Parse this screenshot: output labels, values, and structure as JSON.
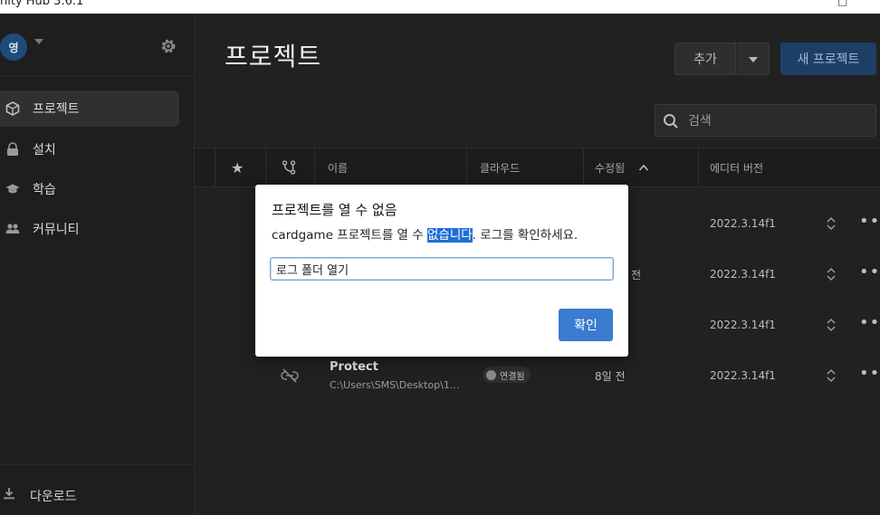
{
  "window": {
    "title": "nity Hub 3.6.1"
  },
  "sidebar": {
    "avatar_initial": "영",
    "items": [
      {
        "label": "프로젝트",
        "icon": "cube-icon",
        "active": true
      },
      {
        "label": "설치",
        "icon": "lock-icon",
        "active": false
      },
      {
        "label": "학습",
        "icon": "graduation-cap-icon",
        "active": false
      },
      {
        "label": "커뮤니티",
        "icon": "people-icon",
        "active": false
      }
    ],
    "download_label": "다운로드"
  },
  "main": {
    "page_title": "프로젝트",
    "add_label": "추가",
    "new_project_label": "새 프로젝트",
    "search_placeholder": "검색",
    "columns": {
      "name": "이름",
      "cloud": "클라우드",
      "modified": "수정됨",
      "editor_version": "에디터 버전"
    },
    "rows": [
      {
        "editor_version": "2022.3.14f1"
      },
      {
        "modified_fragment": "전",
        "editor_version": "2022.3.14f1"
      },
      {
        "editor_version": "2022.3.14f1"
      },
      {
        "name": "Protect",
        "path": "C:\\Users\\SMS\\Desktop\\1...",
        "cloud": "연결됨",
        "modified": "8일 전",
        "editor_version": "2022.3.14f1"
      }
    ]
  },
  "dialog": {
    "title": "프로젝트를 열 수 없음",
    "message_before": "cardgame 프로젝트를 열 수 ",
    "message_highlight": "없습니다",
    "message_after": ". 로그를 확인하세요.",
    "open_log_label": "로그 폴더 열기",
    "ok_label": "확인"
  },
  "colors": {
    "accent": "#3b7bd0",
    "highlight": "#1e6fd9",
    "new_button": "#1d3f66"
  }
}
